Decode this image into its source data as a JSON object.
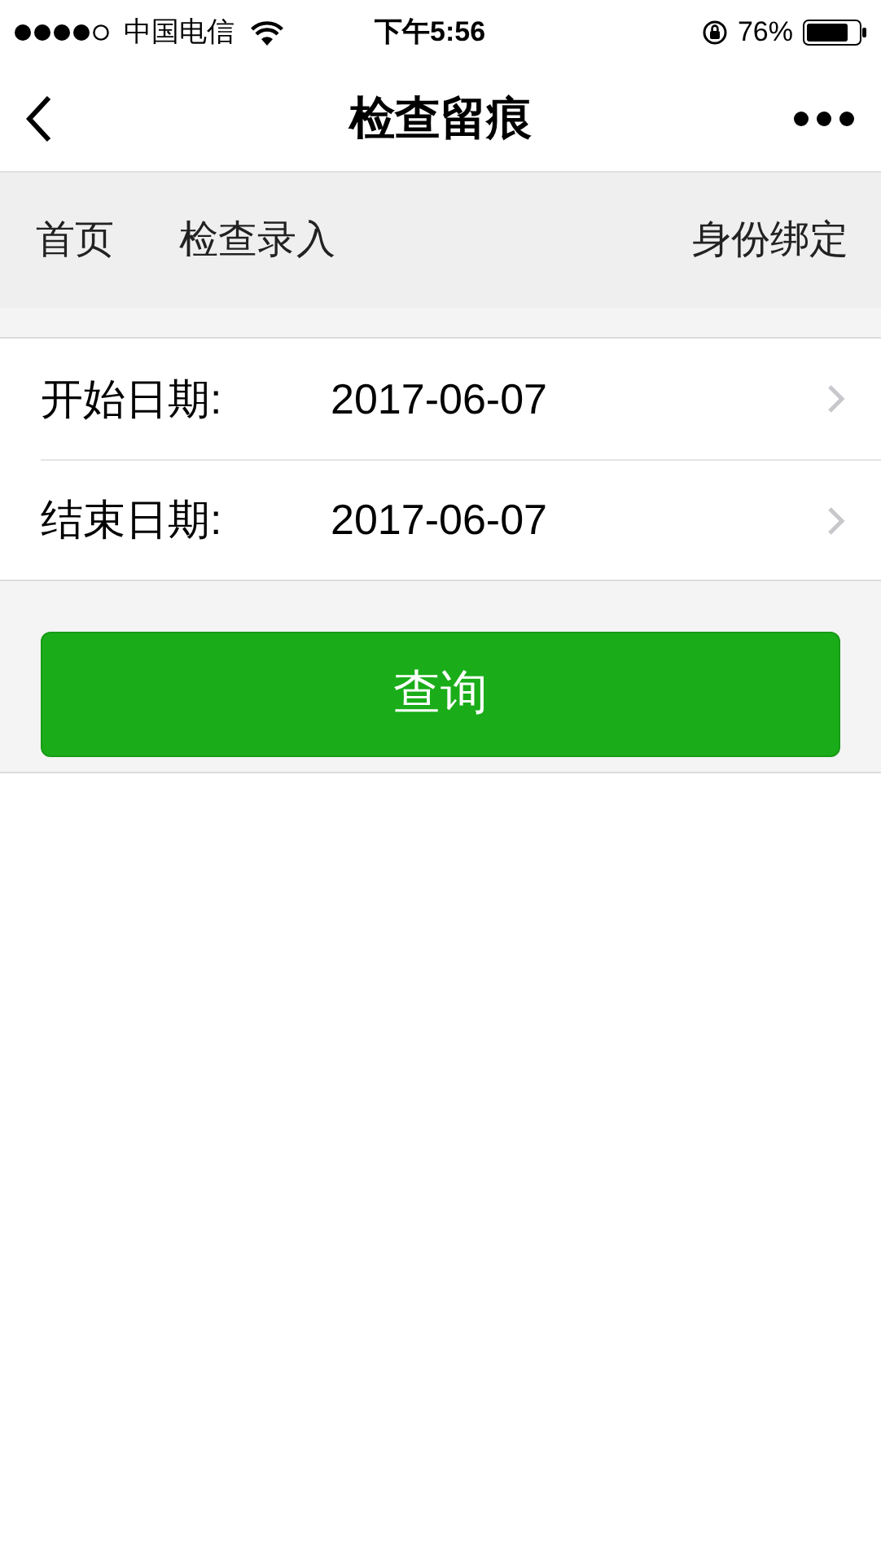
{
  "status_bar": {
    "carrier": "中国电信",
    "time": "下午5:56",
    "battery": "76%"
  },
  "nav_bar": {
    "title": "检查留痕"
  },
  "tabs": [
    {
      "label": "首页"
    },
    {
      "label": "检查录入"
    },
    {
      "label": "身份绑定"
    }
  ],
  "form": {
    "rows": [
      {
        "label": "开始日期:",
        "value": "2017-06-07"
      },
      {
        "label": "结束日期:",
        "value": "2017-06-07"
      }
    ]
  },
  "query_button": {
    "label": "查询"
  }
}
